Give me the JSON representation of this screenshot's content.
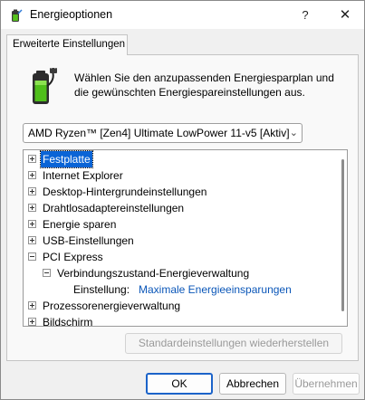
{
  "window": {
    "title": "Energieoptionen",
    "help_label": "?",
    "close_label": "✕"
  },
  "tab": {
    "label": "Erweiterte Einstellungen"
  },
  "description": "Wählen Sie den anzupassenden Energiesparplan und die gewünschten Energiespareinstellungen aus.",
  "plan_dropdown": {
    "selected": "AMD Ryzen™ [Zen4] Ultimate LowPower 11-v5 [Aktiv]"
  },
  "tree": {
    "items": [
      {
        "label": "Festplatte",
        "state": "collapsed",
        "selected": true
      },
      {
        "label": "Internet Explorer",
        "state": "collapsed"
      },
      {
        "label": "Desktop-Hintergrundeinstellungen",
        "state": "collapsed"
      },
      {
        "label": "Drahtlosadaptereinstellungen",
        "state": "collapsed"
      },
      {
        "label": "Energie sparen",
        "state": "collapsed"
      },
      {
        "label": "USB-Einstellungen",
        "state": "collapsed"
      },
      {
        "label": "PCI Express",
        "state": "expanded"
      },
      {
        "label": "Verbindungszustand-Energieverwaltung",
        "state": "expanded"
      },
      {
        "label": "Einstellung:",
        "value": "Maximale Energieeinsparungen"
      },
      {
        "label": "Prozessorenergieverwaltung",
        "state": "collapsed"
      },
      {
        "label": "Bildschirm",
        "state": "collapsed"
      }
    ]
  },
  "buttons": {
    "restore": "Standardeinstellungen wiederherstellen",
    "ok": "OK",
    "cancel": "Abbrechen",
    "apply": "Übernehmen"
  },
  "colors": {
    "selection": "#0a64d6",
    "link": "#0a56b8",
    "default_button_border": "#1b63c9"
  },
  "icons": {
    "title": "power-options-icon",
    "header": "battery-plug-icon"
  }
}
